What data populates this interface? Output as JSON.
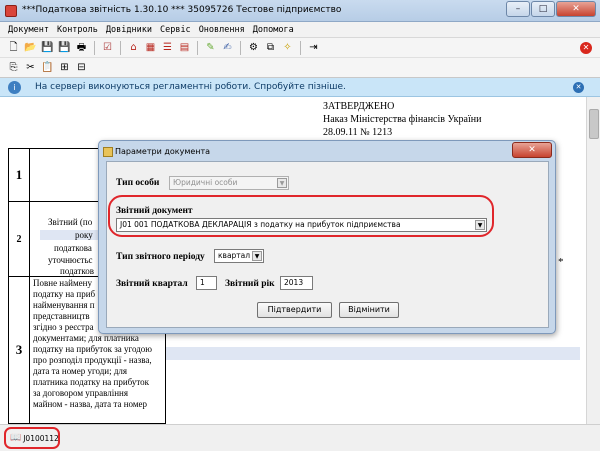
{
  "window": {
    "title": "***Податкова звітність 1.30.10 *** 35095726 Тестове підприємство",
    "minimize": "–",
    "maximize": "□",
    "close": "✕"
  },
  "menu": [
    "Документ",
    "Контроль",
    "Довідники",
    "Сервіс",
    "Оновлення",
    "Допомога"
  ],
  "notice": {
    "message": "На сервері виконуються регламентні роботи. Спробуйте пізніше."
  },
  "document": {
    "approval": [
      "ЗАТВЕРДЖЕНО",
      "Наказ Міністерства фінансів України",
      "28.09.11 № 1213"
    ],
    "row_numbers": [
      "1",
      "2",
      "3"
    ],
    "row2_lines": [
      "Звітний (по",
      "року",
      "податкова",
      "уточнюєтьс",
      "податков"
    ],
    "row2_mark": "*",
    "row3_lines": [
      "Повне наймену",
      "податку на приб",
      "найменування п",
      "представництв",
      "згідно з реєстра",
      "документами; для платника",
      "податку на прибуток за угодою",
      "про розподіл продукції - назва,",
      "дата та номер угоди; для",
      "платника податку на прибуток",
      "за договором управління",
      "майном - назва, дата та номер"
    ]
  },
  "dialog": {
    "title": "Параметри документа",
    "close": "✕",
    "person_type_label": "Тип особи",
    "person_type_value": "Юридичні особи",
    "report_doc_label": "Звітний документ",
    "report_doc_value": "J01 001 ПОДАТКОВА ДЕКЛАРАЦІЯ з податку на прибуток підприємства",
    "period_type_label": "Тип звітного періоду",
    "period_type_value": "квартал",
    "quarter_label": "Звітний квартал",
    "quarter_value": "1",
    "year_label": "Звітний рік",
    "year_value": "2013",
    "confirm": "Підтвердити",
    "cancel": "Відмінити"
  },
  "status": {
    "code": "J0100112"
  }
}
